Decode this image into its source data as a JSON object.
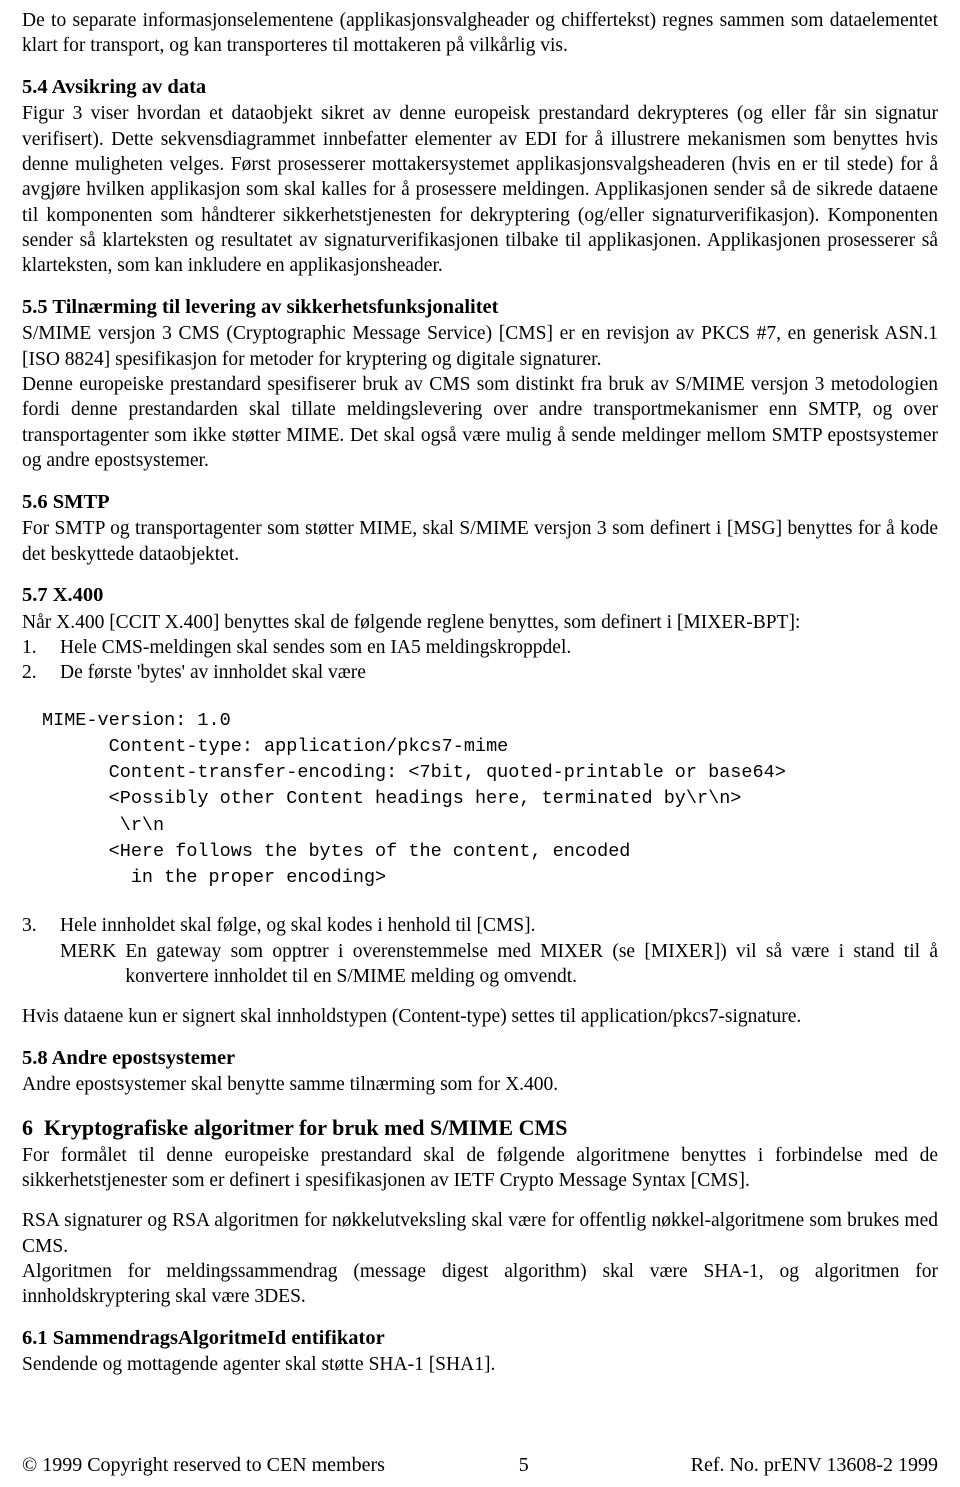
{
  "document": {
    "intro_paragraph": "De to separate informasjonselementene (applikasjonsvalgheader og chiffertekst) regnes sammen som dataelementet klart for transport, og kan transporteres til mottakeren på vilkårlig vis.",
    "sections": [
      {
        "number": "5.4",
        "title": "Avsikring av data",
        "paragraphs": [
          "Figur 3 viser hvordan et dataobjekt sikret av denne europeisk prestandard dekrypteres (og eller får sin signatur verifisert). Dette sekvensdiagrammet innbefatter elementer av EDI for å illustrere mekanismen som benyttes hvis denne muligheten velges. Først prosesserer mottakersystemet applikasjonsvalgsheaderen (hvis en er til stede) for å avgjøre hvilken applikasjon som skal kalles for å prosessere meldingen. Applikasjonen sender så de sikrede dataene til komponenten som håndterer sikkerhetstjenesten for dekryptering (og/eller signaturverifikasjon). Komponenten sender så klarteksten og resultatet av signaturverifikasjonen tilbake til applikasjonen. Applikasjonen prosesserer så klarteksten, som kan inkludere en applikasjonsheader."
        ]
      },
      {
        "number": "5.5",
        "title": "Tilnærming til levering av  sikkerhetsfunksjonalitet",
        "paragraphs": [
          "S/MIME versjon 3 CMS (Cryptographic Message Service) [CMS] er en revisjon av PKCS #7, en generisk ASN.1 [ISO 8824] spesifikasjon for metoder for kryptering og digitale signaturer.",
          "Denne europeiske prestandard spesifiserer bruk av CMS som distinkt fra bruk av S/MIME versjon 3 metodologien fordi denne prestandarden skal tillate meldingslevering over andre transportmekanismer enn SMTP, og over transportagenter som ikke støtter MIME. Det skal også være mulig å sende meldinger mellom SMTP epostsystemer og andre epostsystemer."
        ]
      },
      {
        "number": "5.6",
        "title": "SMTP",
        "paragraphs": [
          "For SMTP og transportagenter som støtter MIME, skal S/MIME versjon 3 som definert i [MSG] benyttes for å kode det beskyttede dataobjektet."
        ]
      },
      {
        "number": "5.7",
        "title": "X.400",
        "paragraphs": [
          "Når X.400 [CCIT X.400] benyttes skal de følgende reglene benyttes, som definert i [MIXER-BPT]:"
        ],
        "list": [
          {
            "marker": "1.",
            "text": "Hele CMS-meldingen skal sendes som en IA5 meldingskroppdel."
          },
          {
            "marker": "2.",
            "text": "De første 'bytes' av innholdet skal være"
          }
        ],
        "code_block": "MIME-version: 1.0\n      Content-type: application/pkcs7-mime\n      Content-transfer-encoding: <7bit, quoted-printable or base64>\n      <Possibly other Content headings here, terminated by\\r\\n>\n       \\r\\n\n      <Here follows the bytes of the content, encoded\n        in the proper encoding>",
        "list2": [
          {
            "marker": "3.",
            "text": "Hele innholdet skal følge, og skal kodes i henhold til [CMS]."
          }
        ],
        "note": {
          "label": "MERK",
          "text": "En gateway som opptrer i overenstemmelse med MIXER (se [MIXER]) vil så være i stand til å konvertere innholdet til en S/MIME melding og omvendt."
        },
        "after_note": "Hvis dataene kun er signert skal innholdstypen (Content-type) settes til application/pkcs7-signature."
      },
      {
        "number": "5.8",
        "title": "Andre epostsystemer",
        "paragraphs": [
          "Andre epostsystemer skal benytte samme tilnærming som for X.400."
        ]
      },
      {
        "number": "6",
        "title": "Kryptografiske algoritmer for bruk med S/MIME CMS",
        "big": true,
        "paragraphs": [
          "For formålet til denne europeiske prestandard skal de følgende algoritmene benyttes i forbindelse med de sikkerhetstjenester som er definert i spesifikasjonen av IETF Crypto Message Syntax [CMS].",
          "RSA signaturer og RSA algoritmen for nøkkelutveksling skal være for offentlig nøkkel-algoritmene som brukes med CMS.",
          "Algoritmen for meldingssammendrag (message digest algorithm) skal være SHA-1, og algoritmen for innholdskryptering skal være 3DES."
        ]
      },
      {
        "number": "6.1",
        "title": "SammendragsAlgoritmeId entifikator",
        "paragraphs": [
          "Sendende og mottagende agenter skal støtte SHA-1 [SHA1]."
        ]
      }
    ]
  },
  "footer": {
    "copyright": "© 1999 Copyright reserved to CEN members",
    "page_number": "5",
    "reference": "Ref. No. prENV 13608-2 1999"
  }
}
